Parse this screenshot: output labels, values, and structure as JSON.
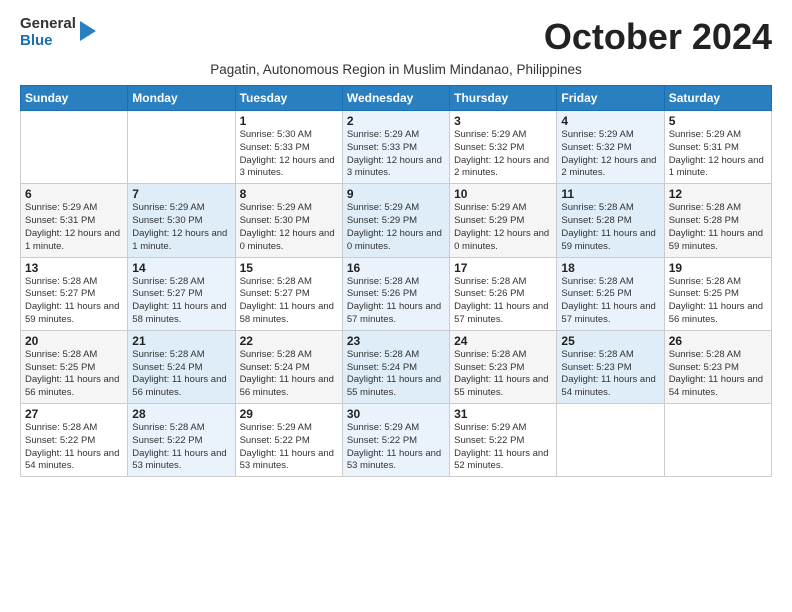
{
  "logo": {
    "line1": "General",
    "line2": "Blue"
  },
  "title": "October 2024",
  "subtitle": "Pagatin, Autonomous Region in Muslim Mindanao, Philippines",
  "days_of_week": [
    "Sunday",
    "Monday",
    "Tuesday",
    "Wednesday",
    "Thursday",
    "Friday",
    "Saturday"
  ],
  "weeks": [
    [
      {
        "num": "",
        "info": ""
      },
      {
        "num": "",
        "info": ""
      },
      {
        "num": "1",
        "info": "Sunrise: 5:30 AM\nSunset: 5:33 PM\nDaylight: 12 hours\nand 3 minutes."
      },
      {
        "num": "2",
        "info": "Sunrise: 5:29 AM\nSunset: 5:33 PM\nDaylight: 12 hours\nand 3 minutes."
      },
      {
        "num": "3",
        "info": "Sunrise: 5:29 AM\nSunset: 5:32 PM\nDaylight: 12 hours\nand 2 minutes."
      },
      {
        "num": "4",
        "info": "Sunrise: 5:29 AM\nSunset: 5:32 PM\nDaylight: 12 hours\nand 2 minutes."
      },
      {
        "num": "5",
        "info": "Sunrise: 5:29 AM\nSunset: 5:31 PM\nDaylight: 12 hours\nand 1 minute."
      }
    ],
    [
      {
        "num": "6",
        "info": "Sunrise: 5:29 AM\nSunset: 5:31 PM\nDaylight: 12 hours\nand 1 minute."
      },
      {
        "num": "7",
        "info": "Sunrise: 5:29 AM\nSunset: 5:30 PM\nDaylight: 12 hours\nand 1 minute."
      },
      {
        "num": "8",
        "info": "Sunrise: 5:29 AM\nSunset: 5:30 PM\nDaylight: 12 hours\nand 0 minutes."
      },
      {
        "num": "9",
        "info": "Sunrise: 5:29 AM\nSunset: 5:29 PM\nDaylight: 12 hours\nand 0 minutes."
      },
      {
        "num": "10",
        "info": "Sunrise: 5:29 AM\nSunset: 5:29 PM\nDaylight: 12 hours\nand 0 minutes."
      },
      {
        "num": "11",
        "info": "Sunrise: 5:28 AM\nSunset: 5:28 PM\nDaylight: 11 hours\nand 59 minutes."
      },
      {
        "num": "12",
        "info": "Sunrise: 5:28 AM\nSunset: 5:28 PM\nDaylight: 11 hours\nand 59 minutes."
      }
    ],
    [
      {
        "num": "13",
        "info": "Sunrise: 5:28 AM\nSunset: 5:27 PM\nDaylight: 11 hours\nand 59 minutes."
      },
      {
        "num": "14",
        "info": "Sunrise: 5:28 AM\nSunset: 5:27 PM\nDaylight: 11 hours\nand 58 minutes."
      },
      {
        "num": "15",
        "info": "Sunrise: 5:28 AM\nSunset: 5:27 PM\nDaylight: 11 hours\nand 58 minutes."
      },
      {
        "num": "16",
        "info": "Sunrise: 5:28 AM\nSunset: 5:26 PM\nDaylight: 11 hours\nand 57 minutes."
      },
      {
        "num": "17",
        "info": "Sunrise: 5:28 AM\nSunset: 5:26 PM\nDaylight: 11 hours\nand 57 minutes."
      },
      {
        "num": "18",
        "info": "Sunrise: 5:28 AM\nSunset: 5:25 PM\nDaylight: 11 hours\nand 57 minutes."
      },
      {
        "num": "19",
        "info": "Sunrise: 5:28 AM\nSunset: 5:25 PM\nDaylight: 11 hours\nand 56 minutes."
      }
    ],
    [
      {
        "num": "20",
        "info": "Sunrise: 5:28 AM\nSunset: 5:25 PM\nDaylight: 11 hours\nand 56 minutes."
      },
      {
        "num": "21",
        "info": "Sunrise: 5:28 AM\nSunset: 5:24 PM\nDaylight: 11 hours\nand 56 minutes."
      },
      {
        "num": "22",
        "info": "Sunrise: 5:28 AM\nSunset: 5:24 PM\nDaylight: 11 hours\nand 56 minutes."
      },
      {
        "num": "23",
        "info": "Sunrise: 5:28 AM\nSunset: 5:24 PM\nDaylight: 11 hours\nand 55 minutes."
      },
      {
        "num": "24",
        "info": "Sunrise: 5:28 AM\nSunset: 5:23 PM\nDaylight: 11 hours\nand 55 minutes."
      },
      {
        "num": "25",
        "info": "Sunrise: 5:28 AM\nSunset: 5:23 PM\nDaylight: 11 hours\nand 54 minutes."
      },
      {
        "num": "26",
        "info": "Sunrise: 5:28 AM\nSunset: 5:23 PM\nDaylight: 11 hours\nand 54 minutes."
      }
    ],
    [
      {
        "num": "27",
        "info": "Sunrise: 5:28 AM\nSunset: 5:22 PM\nDaylight: 11 hours\nand 54 minutes."
      },
      {
        "num": "28",
        "info": "Sunrise: 5:28 AM\nSunset: 5:22 PM\nDaylight: 11 hours\nand 53 minutes."
      },
      {
        "num": "29",
        "info": "Sunrise: 5:29 AM\nSunset: 5:22 PM\nDaylight: 11 hours\nand 53 minutes."
      },
      {
        "num": "30",
        "info": "Sunrise: 5:29 AM\nSunset: 5:22 PM\nDaylight: 11 hours\nand 53 minutes."
      },
      {
        "num": "31",
        "info": "Sunrise: 5:29 AM\nSunset: 5:22 PM\nDaylight: 11 hours\nand 52 minutes."
      },
      {
        "num": "",
        "info": ""
      },
      {
        "num": "",
        "info": ""
      }
    ]
  ]
}
